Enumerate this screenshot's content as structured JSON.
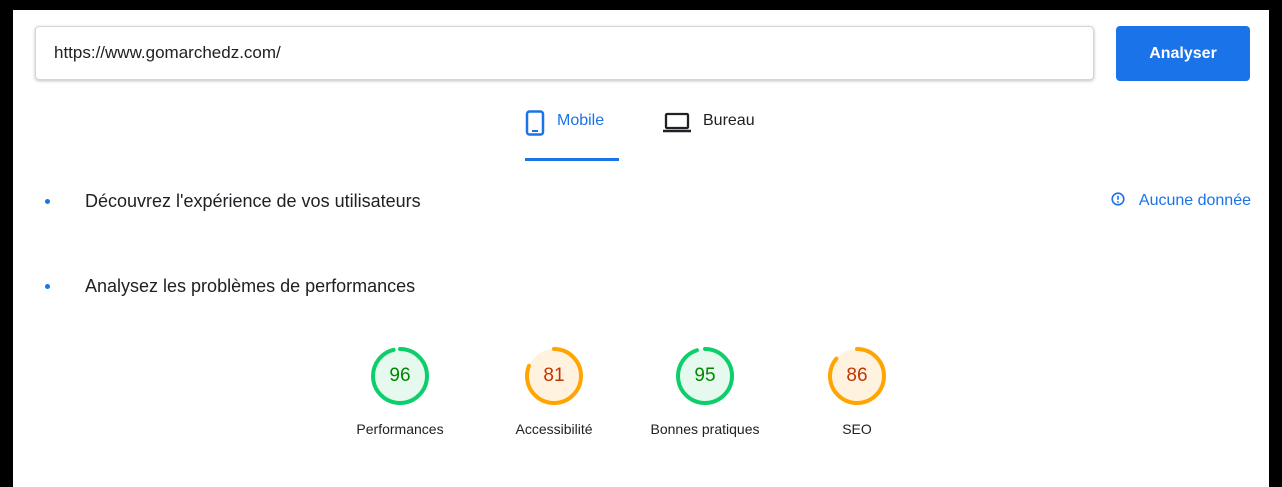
{
  "search": {
    "url_value": "https://www.gomarchedz.com/",
    "analyze_label": "Analyser"
  },
  "tabs": [
    {
      "label": "Mobile",
      "icon": "smartphone-icon",
      "active": true
    },
    {
      "label": "Bureau",
      "icon": "laptop-icon",
      "active": false
    }
  ],
  "sections": {
    "field": {
      "title": "Découvrez l'expérience de vos utilisateurs",
      "no_data_label": "Aucune donnée",
      "no_data_icon": "info-icon"
    },
    "lab": {
      "title": "Analysez les problèmes de performances"
    }
  },
  "scores": [
    {
      "label": "Performances",
      "value": 96,
      "rating": "pass"
    },
    {
      "label": "Accessibilité",
      "value": 81,
      "rating": "average"
    },
    {
      "label": "Bonnes pratiques",
      "value": 95,
      "rating": "pass"
    },
    {
      "label": "SEO",
      "value": 86,
      "rating": "average"
    }
  ],
  "colors": {
    "accent": "#1a73e8",
    "pass_ring": "#0cce6b",
    "pass_text": "#008800",
    "pass_bg": "#e6f9ee",
    "average_ring": "#ffa400",
    "average_text": "#c33300",
    "average_bg": "#fff3e0"
  }
}
